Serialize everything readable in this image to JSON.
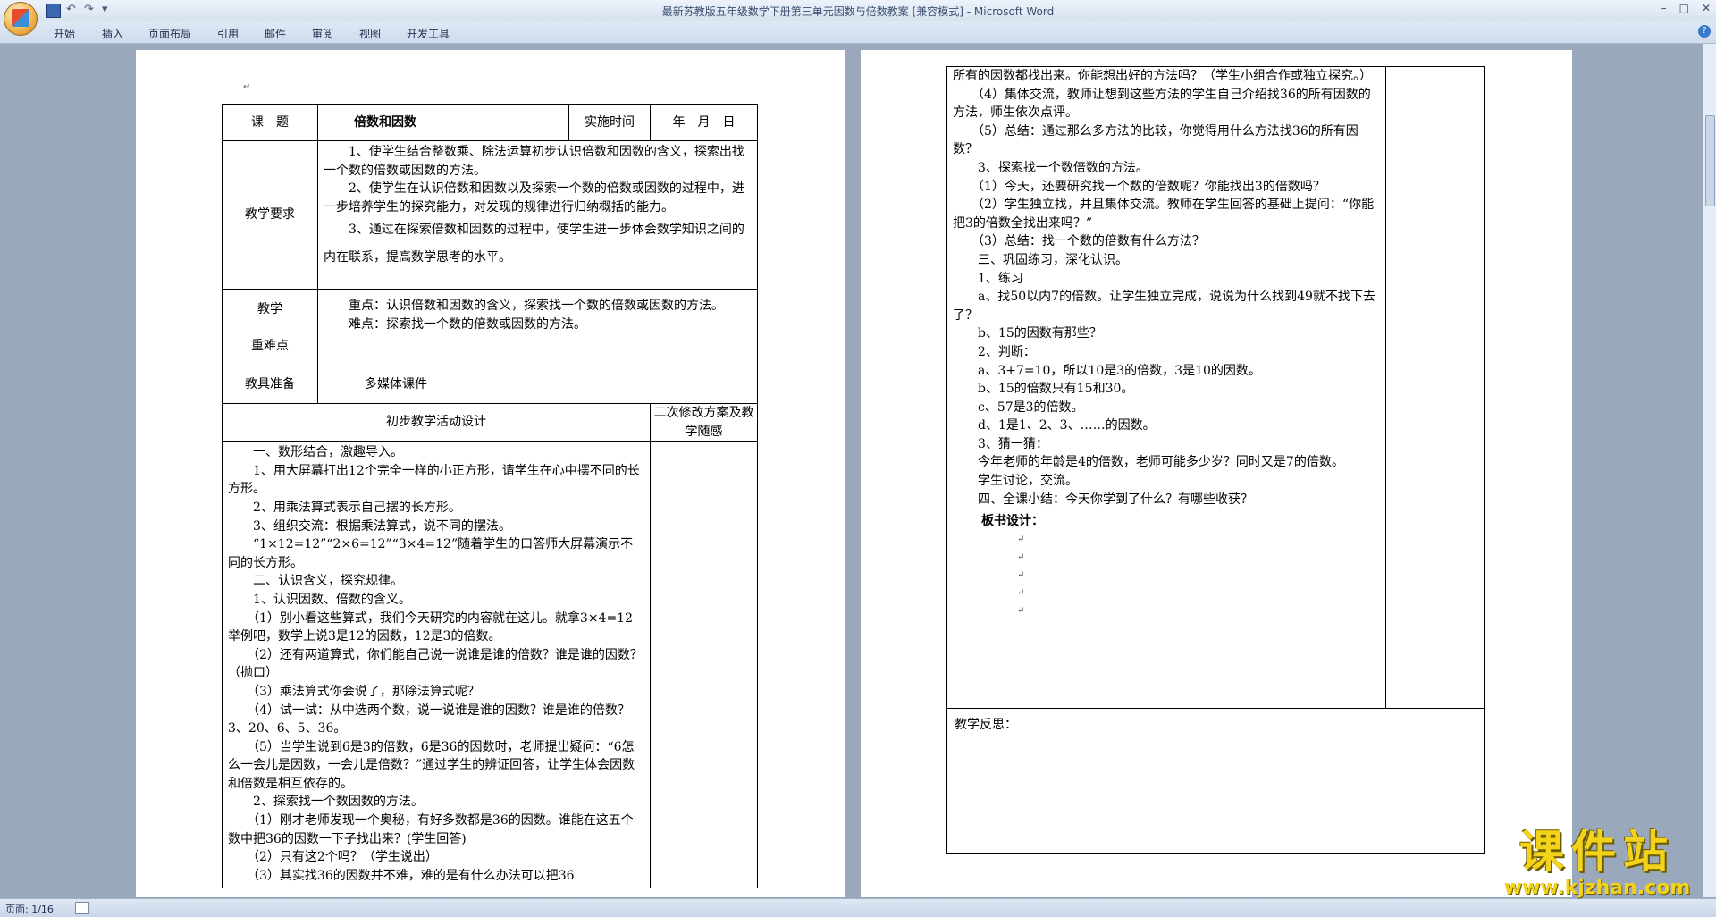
{
  "window": {
    "title": "最新苏教版五年级数学下册第三单元因数与倍数教案 [兼容模式] - Microsoft Word"
  },
  "ribbon_tabs": [
    "开始",
    "插入",
    "页面布局",
    "引用",
    "邮件",
    "审阅",
    "视图",
    "开发工具"
  ],
  "status": {
    "page_info": "页面: 1/16"
  },
  "watermark": {
    "title": "课件站",
    "url": "www.kjzhan.com"
  },
  "left_page": {
    "label_topic": "课　题",
    "topic": "倍数和因数",
    "label_time": "实施时间",
    "time_value": "年　月　日",
    "label_req": "教学要求",
    "requirements": [
      "　　1、使学生结合整数乘、除法运算初步认识倍数和因数的含义，探索出找一个数的倍数或因数的方法。",
      "　　2、使学生在认识倍数和因数以及探索一个数的倍数或因数的过程中，进一步培养学生的探究能力，对发现的规律进行归纳概括的能力。",
      "　　3、通过在探索倍数和因数的过程中，使学生进一步体会数学知识之间的内在联系，提高数学思考的水平。"
    ],
    "label_key1": "教学",
    "label_key2": "重难点",
    "keypoints": [
      "　　重点：认识倍数和因数的含义，探索找一个数的倍数或因数的方法。",
      "　　难点：探索找一个数的倍数或因数的方法。"
    ],
    "label_tools": "教具准备",
    "tools": "多媒体课件",
    "design_header": "初步教学活动设计",
    "revision_header": "二次修改方案及教学随感",
    "design_lines": [
      "　　一、数形结合，激趣导入。",
      "　　1、用大屏幕打出12个完全一样的小正方形，请学生在心中摆不同的长方形。",
      "　　2、用乘法算式表示自己摆的长方形。",
      "　　3、组织交流：根据乘法算式，说不同的摆法。",
      "　　“1×12=12”“2×6=12”“3×4=12”随着学生的口答师大屏幕演示不同的长方形。",
      "　　二、认识含义，探究规律。",
      "　　1、认识因数、倍数的含义。",
      "　　（1）别小看这些算式，我们今天研究的内容就在这儿。就拿3×4=12举例吧，数学上说3是12的因数，12是3的倍数。",
      "　　（2）还有两道算式，你们能自己说一说谁是谁的倍数？谁是谁的因数？（抛口）",
      "　　（3）乘法算式你会说了，那除法算式呢？",
      "　　（4）试一试：从中选两个数，说一说谁是谁的因数？谁是谁的倍数？3、20、6、5、36。",
      "　　（5）当学生说到6是3的倍数，6是36的因数时，老师提出疑问：“6怎么一会儿是因数，一会儿是倍数？”通过学生的辨证回答，让学生体会因数和倍数是相互依存的。",
      "　　2、探索找一个数因数的方法。",
      "　　（1）刚才老师发现一个奥秘，有好多数都是36的因数。谁能在这五个数中把36的因数一下子找出来？(学生回答)",
      "　　（2）只有这2个吗？（学生说出）",
      "　　（3）其实找36的因数并不难，难的是有什么办法可以把36"
    ]
  },
  "right_page": {
    "lines": [
      "所有的因数都找出来。你能想出好的方法吗？（学生小组合作或独立探究。）",
      "　　（4）集体交流，教师让想到这些方法的学生自己介绍找36的所有因数的方法，师生依次点评。",
      "　　（5）总结：通过那么多方法的比较，你觉得用什么方法找36的所有因数？",
      "　　3、探索找一个数倍数的方法。",
      "　　（1）今天，还要研究找一个数的倍数呢？你能找出3的倍数吗？",
      "　　（2）学生独立找，并且集体交流。教师在学生回答的基础上提问：“你能把3的倍数全找出来吗？”",
      "　　（3）总结：找一个数的倍数有什么方法？",
      "　　三、巩固练习，深化认识。",
      "　　1、练习",
      "　　a、找50以内7的倍数。让学生独立完成，说说为什么找到49就不找下去了？",
      "　　b、15的因数有那些？",
      "　　2、判断：",
      "　　a、3+7=10，所以10是3的倍数，3是10的因数。",
      "　　b、15的倍数只有15和30。",
      "　　c、57是3的倍数。",
      "　　d、1是1、2、3、……的因数。",
      "　　3、猜一猜：",
      "　　今年老师的年龄是4的倍数，老师可能多少岁？同时又是7的倍数。",
      "　　学生讨论，交流。",
      "　　四、全课小结：今天你学到了什么？有哪些收获？"
    ],
    "board_label": "板书设计：",
    "reflection_label": "教学反思："
  }
}
